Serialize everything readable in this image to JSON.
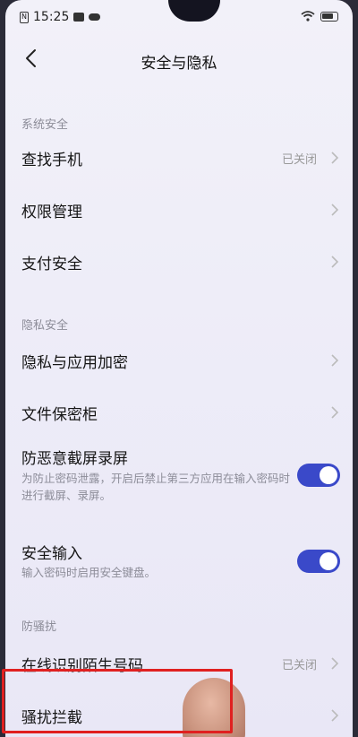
{
  "status_bar": {
    "time": "15:25",
    "sim": "N"
  },
  "header": {
    "title": "安全与隐私"
  },
  "sections": {
    "system_security": "系统安全",
    "privacy_security": "隐私安全",
    "anti_harass": "防骚扰"
  },
  "rows": {
    "find_phone": {
      "label": "查找手机",
      "value": "已关闭"
    },
    "permission": {
      "label": "权限管理"
    },
    "payment": {
      "label": "支付安全"
    },
    "privacy_encrypt": {
      "label": "隐私与应用加密"
    },
    "file_safe": {
      "label": "文件保密柜"
    },
    "anti_screenshot": {
      "label": "防恶意截屏录屏",
      "desc": "为防止密码泄露，开启后禁止第三方应用在输入密码时进行截屏、录屏。",
      "enabled": true
    },
    "secure_input": {
      "label": "安全输入",
      "desc": "输入密码时启用安全键盘。",
      "enabled": true
    },
    "online_identify": {
      "label": "在线识别陌生号码",
      "value": "已关闭"
    },
    "harass_block": {
      "label": "骚扰拦截"
    }
  },
  "colors": {
    "accent": "#3a49c9",
    "highlight": "#e02020"
  }
}
